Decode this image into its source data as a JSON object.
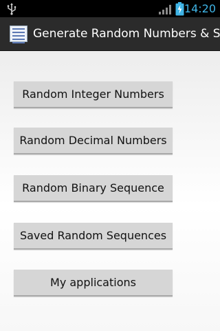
{
  "status_bar": {
    "time": "14:20",
    "icons": [
      "usb-icon",
      "signal-icon",
      "battery-charging-icon"
    ],
    "accent_color": "#3fb4e6"
  },
  "action_bar": {
    "title": "Generate Random Numbers & Seq",
    "icon": "app-icon",
    "background": "#2b2b2b"
  },
  "menu": {
    "buttons": [
      {
        "label": "Random Integer Numbers"
      },
      {
        "label": "Random Decimal Numbers"
      },
      {
        "label": "Random Binary Sequence"
      },
      {
        "label": "Saved Random Sequences"
      },
      {
        "label": "My applications"
      }
    ]
  }
}
